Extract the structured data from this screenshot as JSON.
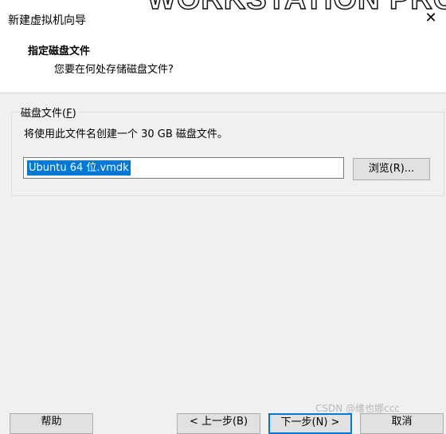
{
  "window": {
    "title": "新建虚拟机向导",
    "background_text": "WORKSTATION PRO"
  },
  "header": {
    "title": "指定磁盘文件",
    "subtitle": "您要在何处存储磁盘文件?"
  },
  "disk_group": {
    "label_prefix": "磁盘文件(",
    "label_key": "F",
    "label_suffix": ")",
    "info": "将使用此文件名创建一个 30 GB 磁盘文件。",
    "file_value": "Ubuntu 64 位.vmdk",
    "browse_label": "浏览(R)..."
  },
  "buttons": {
    "help": "帮助",
    "back": "< 上一步(B)",
    "next": "下一步(N) >",
    "cancel": "取消"
  },
  "watermark": "CSDN @维也娜ccc",
  "colors": {
    "selection": "#0078d7",
    "default_button_border": "#0078d7"
  }
}
